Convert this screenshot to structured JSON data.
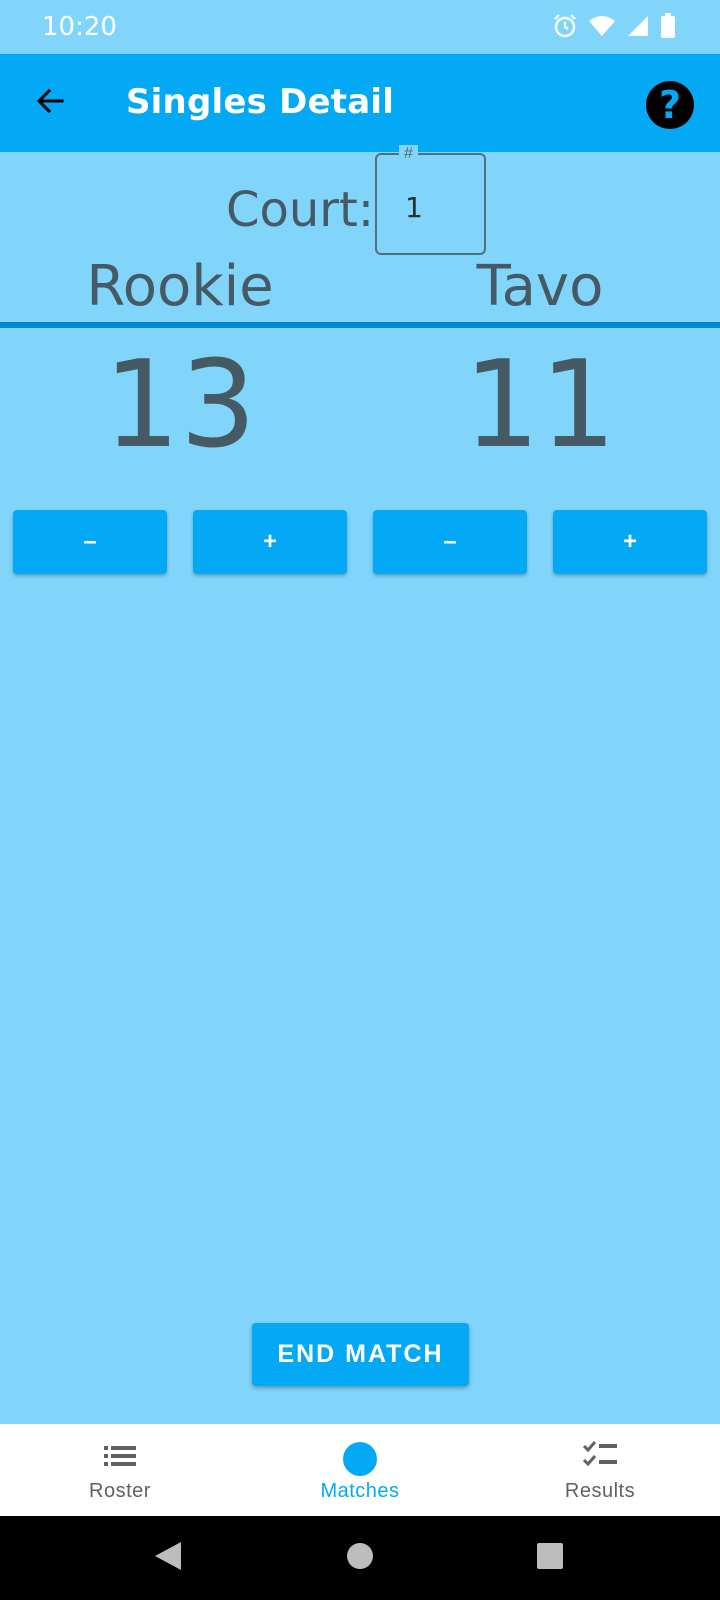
{
  "status_bar": {
    "time": "10:20",
    "icons": [
      "alarm-icon",
      "wifi-icon",
      "signal-icon",
      "battery-icon"
    ]
  },
  "app_bar": {
    "title": "Singles Detail",
    "back_icon": "arrow-back-icon",
    "help_icon": "help-icon",
    "color": "#03a9f4"
  },
  "court": {
    "label": "Court:",
    "field_legend": "#",
    "value": "1"
  },
  "players": [
    {
      "name": "Rookie",
      "score": "13"
    },
    {
      "name": "Tavo",
      "score": "11"
    }
  ],
  "score_buttons": {
    "minus_label": "–",
    "plus_label": "+"
  },
  "end_match_label": "END MATCH",
  "bottom_nav": {
    "items": [
      {
        "label": "Roster",
        "icon": "list-icon",
        "active": false
      },
      {
        "label": "Matches",
        "icon": "circle-icon",
        "active": true
      },
      {
        "label": "Results",
        "icon": "checklist-icon",
        "active": false
      }
    ]
  },
  "colors": {
    "background": "#81d4fa",
    "accent": "#03a9f4",
    "divider": "#0288d1",
    "text": "#455a64"
  }
}
